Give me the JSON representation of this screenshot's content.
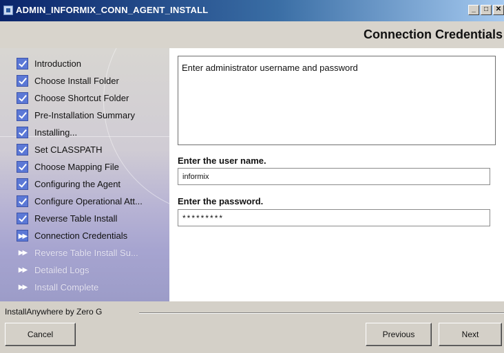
{
  "window": {
    "title": "ADMIN_INFORMIX_CONN_AGENT_INSTALL",
    "minimize_symbol": "_",
    "maximize_symbol": "□",
    "close_symbol": "✕"
  },
  "header": {
    "title": "Connection Credentials"
  },
  "steps": [
    {
      "label": "Introduction",
      "status": "done"
    },
    {
      "label": "Choose Install Folder",
      "status": "done"
    },
    {
      "label": "Choose Shortcut Folder",
      "status": "done"
    },
    {
      "label": "Pre-Installation Summary",
      "status": "done"
    },
    {
      "label": "Installing...",
      "status": "done"
    },
    {
      "label": "Set CLASSPATH",
      "status": "done"
    },
    {
      "label": "Choose Mapping File",
      "status": "done"
    },
    {
      "label": "Configuring the Agent",
      "status": "done"
    },
    {
      "label": "Configure Operational Att...",
      "status": "done"
    },
    {
      "label": "Reverse Table Install",
      "status": "done"
    },
    {
      "label": "Connection Credentials",
      "status": "current"
    },
    {
      "label": "Reverse Table Install Su...",
      "status": "pending"
    },
    {
      "label": "Detailed Logs",
      "status": "pending"
    },
    {
      "label": "Install Complete",
      "status": "pending"
    }
  ],
  "main": {
    "description": "Enter administrator username and password",
    "username_label": "Enter the user name.",
    "username_value": "informix",
    "password_label": "Enter the password.",
    "password_value": "*********"
  },
  "footer": {
    "brand": "InstallAnywhere by Zero G",
    "cancel_label": "Cancel",
    "previous_label": "Previous",
    "next_label": "Next"
  },
  "colors": {
    "titlebar_dark": "#0a246a",
    "titlebar_light": "#a6caf0",
    "checkbox": "#5b78d6",
    "panel_bottom": "#9c9cc8"
  }
}
